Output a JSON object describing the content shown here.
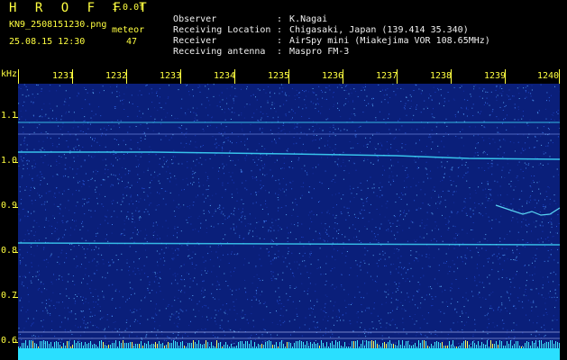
{
  "header": {
    "app_title": "H R O F F T",
    "version": "1.0.0f",
    "filename": "KN9_2508151230.png",
    "meteor_label": "meteor",
    "meteor_count": "47",
    "datetime": "25.08.15 12:30"
  },
  "metadata": [
    {
      "key": "Observer",
      "value": "K.Nagai"
    },
    {
      "key": "Receiving Location",
      "value": "Chigasaki, Japan (139.414 35.340)"
    },
    {
      "key": "Receiver",
      "value": "AirSpy mini (Miakejima VOR 108.65MHz)"
    },
    {
      "key": "Receiving antenna",
      "value": "Maspro FM-3"
    }
  ],
  "axis": {
    "y_unit": "kHz",
    "time_ticks": [
      "1231",
      "1232",
      "1233",
      "1234",
      "1235",
      "1236",
      "1237",
      "1238",
      "1239",
      "1240"
    ],
    "freq_ticks": [
      "1.1",
      "1.0",
      "0.9",
      "0.8",
      "0.7",
      "0.6"
    ]
  },
  "colors": {
    "background": "#000000",
    "waterfall_base": "#0a1f7a",
    "label_yellow": "#ffff40",
    "signal_cyan": "#40e0ff"
  }
}
